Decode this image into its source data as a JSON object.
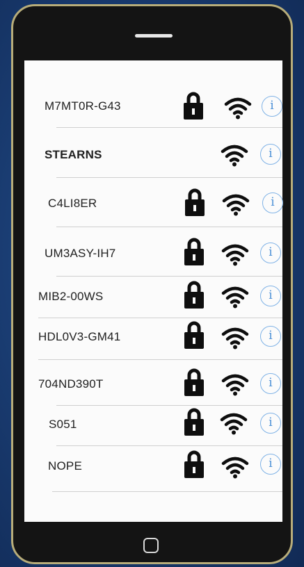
{
  "networks": [
    {
      "ssid": "M7MT0R-G43",
      "secured": true,
      "info_label": "i"
    },
    {
      "ssid": "STEARNS",
      "secured": false,
      "info_label": "i"
    },
    {
      "ssid": "C4LI8ER",
      "secured": true,
      "info_label": "i"
    },
    {
      "ssid": "UM3ASY-IH7",
      "secured": true,
      "info_label": "i"
    },
    {
      "ssid": "MIB2-00WS",
      "secured": true,
      "info_label": "i"
    },
    {
      "ssid": "HDL0V3-GM41",
      "secured": true,
      "info_label": "i"
    },
    {
      "ssid": "704ND390T",
      "secured": true,
      "info_label": "i"
    },
    {
      "ssid": "S051",
      "secured": true,
      "info_label": "i"
    },
    {
      "ssid": "NOPE",
      "secured": true,
      "info_label": "i"
    }
  ],
  "icons": {
    "lock": "lock-icon",
    "wifi": "wifi-signal-icon",
    "info": "info-icon",
    "home": "home-button"
  },
  "colors": {
    "background": "#1a3d73",
    "phone_body": "#141414",
    "phone_border": "#b8ad7a",
    "screen": "#fbfbfb",
    "info_accent": "#4a8fd6"
  }
}
